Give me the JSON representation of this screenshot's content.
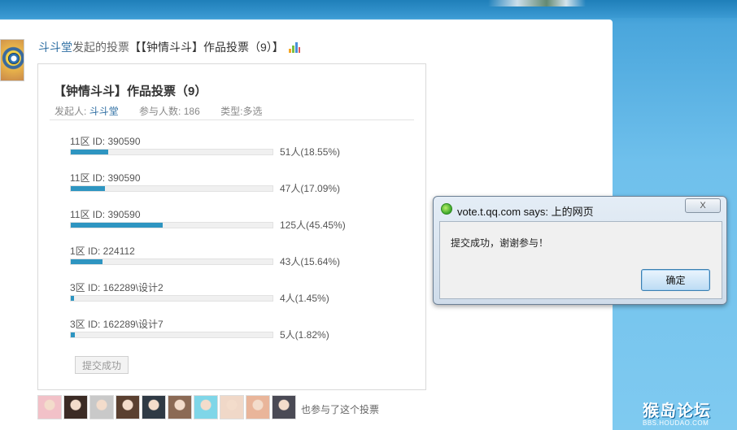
{
  "headline": {
    "author": "斗斗堂",
    "verb": "发起的投票",
    "title": "【【钟情斗斗】作品投票（9）】"
  },
  "poll": {
    "title": "【钟情斗斗】作品投票（9）",
    "initiator_label": "发起人:",
    "initiator": "斗斗堂",
    "participants_label": "参与人数:",
    "participants": "186",
    "type_label": "类型:多选",
    "options": [
      {
        "label": "11区 ID: 390590",
        "result": "51人(18.55%)",
        "percent": 18.55
      },
      {
        "label": "11区 ID: 390590",
        "result": "47人(17.09%)",
        "percent": 17.09
      },
      {
        "label": "11区 ID: 390590",
        "result": "125人(45.45%)",
        "percent": 45.45
      },
      {
        "label": "1区 ID: 224112",
        "result": "43人(15.64%)",
        "percent": 15.64
      },
      {
        "label": "3区 ID: 162289\\设计2",
        "result": "4人(1.45%)",
        "percent": 1.45
      },
      {
        "label": "3区 ID: 162289\\设计7",
        "result": "5人(1.82%)",
        "percent": 1.82
      }
    ],
    "submit_label": "提交成功"
  },
  "participants_strip": {
    "label": "也参与了这个投票",
    "faces": [
      "#f2c1c8",
      "#3b2b25",
      "#c9c9c9",
      "#5a4030",
      "#2f3a45",
      "#8b6a55",
      "#7fd6e8",
      "#f0d8c8",
      "#e9b59a",
      "#4a4a55"
    ]
  },
  "dialog": {
    "title": "vote.t.qq.com says: 上的网页",
    "close_label": "X",
    "message": "提交成功，谢谢参与！",
    "ok_label": "确定"
  },
  "watermark": {
    "main": "猴岛论坛",
    "sub": "BBS.HOUDAO.COM"
  },
  "colors": {
    "bar_fill": "#2e95c1",
    "link": "#2f6fa3",
    "background_blue": "#6fc0ec"
  }
}
